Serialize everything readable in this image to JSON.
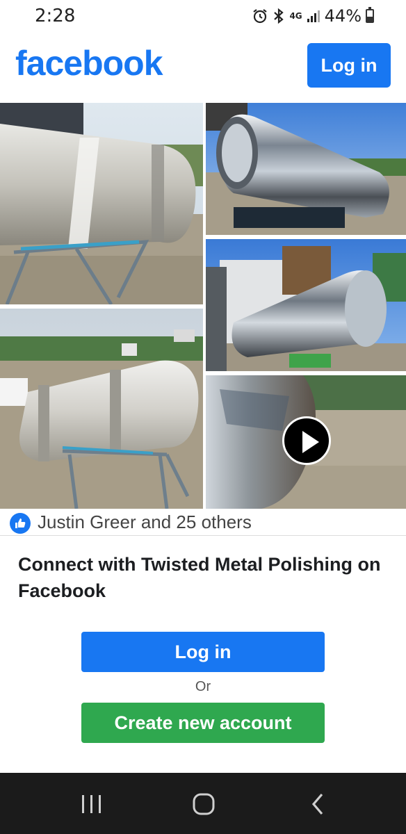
{
  "status_bar": {
    "time": "2:28",
    "network": "4G",
    "battery": "44%",
    "icons": [
      "alarm-icon",
      "bluetooth-icon",
      "network-4g-icon",
      "signal-icon",
      "battery-icon"
    ]
  },
  "header": {
    "logo": "facebook",
    "login_label": "Log in",
    "brand_color": "#1877f2"
  },
  "photos": [
    {
      "name": "photo-unpolished-tank-1"
    },
    {
      "name": "photo-polished-tank-1"
    },
    {
      "name": "photo-polished-tank-2"
    },
    {
      "name": "photo-unpolished-tank-2"
    },
    {
      "name": "photo-video-polished-tank",
      "is_video": true,
      "icon": "play-icon"
    }
  ],
  "reactions": {
    "icon": "like-icon",
    "text": "Justin Greer and 25 others"
  },
  "connect": {
    "title": "Connect with Twisted Metal Polishing on Facebook",
    "login_label": "Log in",
    "or_text": "Or",
    "create_label": "Create new account",
    "create_color": "#2fa84f"
  },
  "nav": {
    "icons": [
      "recent-apps-icon",
      "home-icon",
      "back-icon"
    ]
  }
}
